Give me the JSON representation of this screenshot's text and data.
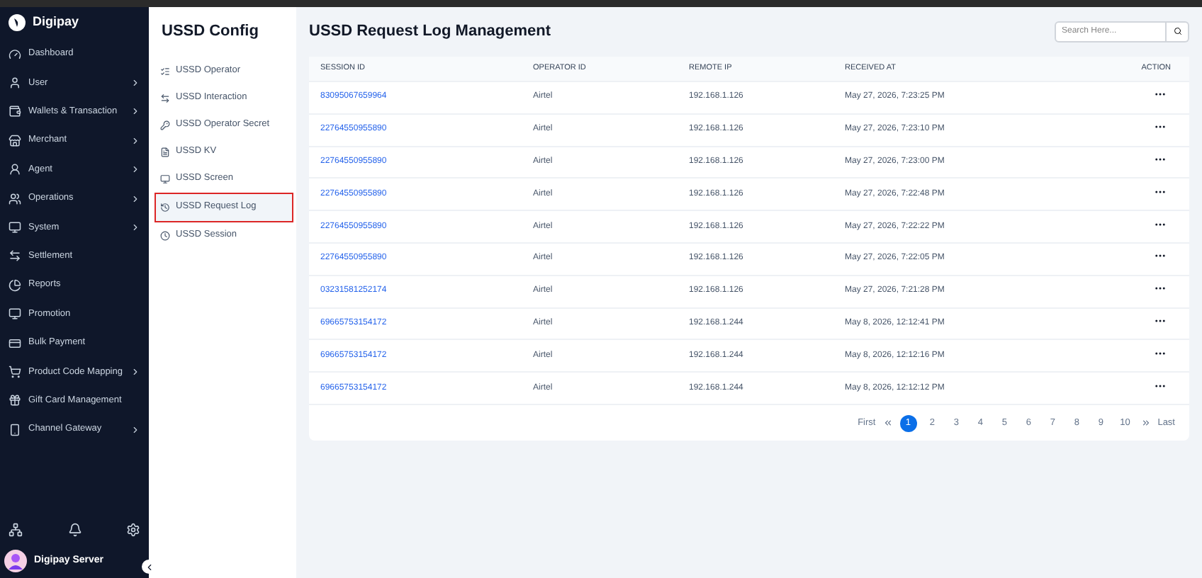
{
  "brand": "Digipay",
  "nav": [
    {
      "label": "Dashboard",
      "has_submenu": false
    },
    {
      "label": "User",
      "has_submenu": true
    },
    {
      "label": "Wallets & Transaction",
      "has_submenu": true
    },
    {
      "label": "Merchant",
      "has_submenu": true
    },
    {
      "label": "Agent",
      "has_submenu": true
    },
    {
      "label": "Operations",
      "has_submenu": true
    },
    {
      "label": "System",
      "has_submenu": true
    },
    {
      "label": "Settlement",
      "has_submenu": false
    },
    {
      "label": "Reports",
      "has_submenu": false
    },
    {
      "label": "Promotion",
      "has_submenu": false
    },
    {
      "label": "Bulk Payment",
      "has_submenu": false
    },
    {
      "label": "Product Code Mapping",
      "has_submenu": true
    },
    {
      "label": "Gift Card Management",
      "has_submenu": false
    },
    {
      "label": "Channel Gateway",
      "has_submenu": true
    }
  ],
  "user": {
    "name": "Digipay Server"
  },
  "config": {
    "title": "USSD Config",
    "items": [
      {
        "label": "USSD Operator",
        "selected": false
      },
      {
        "label": "USSD Interaction",
        "selected": false
      },
      {
        "label": "USSD Operator Secret",
        "selected": false
      },
      {
        "label": "USSD KV",
        "selected": false
      },
      {
        "label": "USSD Screen",
        "selected": false
      },
      {
        "label": "USSD Request Log",
        "selected": true
      },
      {
        "label": "USSD Session",
        "selected": false
      }
    ]
  },
  "page": {
    "title": "USSD Request Log Management",
    "search": {
      "placeholder": "Search Here..."
    }
  },
  "table": {
    "columns": [
      "SESSION ID",
      "OPERATOR ID",
      "REMOTE IP",
      "RECEIVED AT",
      "ACTION"
    ],
    "rows": [
      [
        "83095067659964",
        "Airtel",
        "192.168.1.126",
        "May 27, 2026, 7:23:25 PM"
      ],
      [
        "22764550955890",
        "Airtel",
        "192.168.1.126",
        "May 27, 2026, 7:23:10 PM"
      ],
      [
        "22764550955890",
        "Airtel",
        "192.168.1.126",
        "May 27, 2026, 7:23:00 PM"
      ],
      [
        "22764550955890",
        "Airtel",
        "192.168.1.126",
        "May 27, 2026, 7:22:48 PM"
      ],
      [
        "22764550955890",
        "Airtel",
        "192.168.1.126",
        "May 27, 2026, 7:22:22 PM"
      ],
      [
        "22764550955890",
        "Airtel",
        "192.168.1.126",
        "May 27, 2026, 7:22:05 PM"
      ],
      [
        "03231581252174",
        "Airtel",
        "192.168.1.126",
        "May 27, 2026, 7:21:28 PM"
      ],
      [
        "69665753154172",
        "Airtel",
        "192.168.1.244",
        "May 8, 2026, 12:12:41 PM"
      ],
      [
        "69665753154172",
        "Airtel",
        "192.168.1.244",
        "May 8, 2026, 12:12:16 PM"
      ],
      [
        "69665753154172",
        "Airtel",
        "192.168.1.244",
        "May 8, 2026, 12:12:12 PM"
      ]
    ]
  },
  "pagination": {
    "first": "First",
    "last": "Last",
    "pages": [
      {
        "label": "1",
        "selected": true
      },
      {
        "label": "2",
        "selected": false
      },
      {
        "label": "3",
        "selected": false
      },
      {
        "label": "4",
        "selected": false
      },
      {
        "label": "5",
        "selected": false
      },
      {
        "label": "6",
        "selected": false
      },
      {
        "label": "7",
        "selected": false
      },
      {
        "label": "8",
        "selected": false
      },
      {
        "label": "9",
        "selected": false
      },
      {
        "label": "10",
        "selected": false
      }
    ]
  }
}
